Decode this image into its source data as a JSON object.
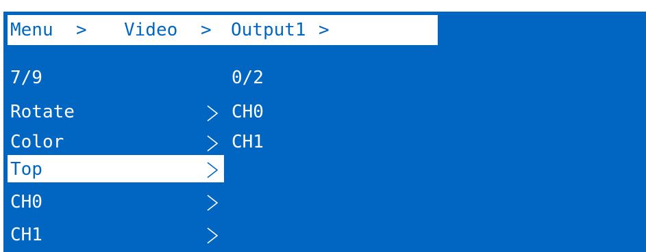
{
  "breadcrumb": {
    "items": [
      "Menu",
      "Video",
      "Output1"
    ],
    "separator": ">"
  },
  "left_column": {
    "position": "7/9",
    "items": [
      {
        "label": "Rotate",
        "selected": false
      },
      {
        "label": "Color",
        "selected": false
      },
      {
        "label": "Top",
        "selected": true
      },
      {
        "label": "CH0",
        "selected": false
      },
      {
        "label": "CH1",
        "selected": false
      }
    ]
  },
  "right_column": {
    "position": "0/2",
    "items": [
      "CH0",
      "CH1"
    ]
  },
  "colors": {
    "background": "#0066c2",
    "text": "#ffffff",
    "highlight": "#ffffff",
    "highlight_text": "#0066c2"
  }
}
